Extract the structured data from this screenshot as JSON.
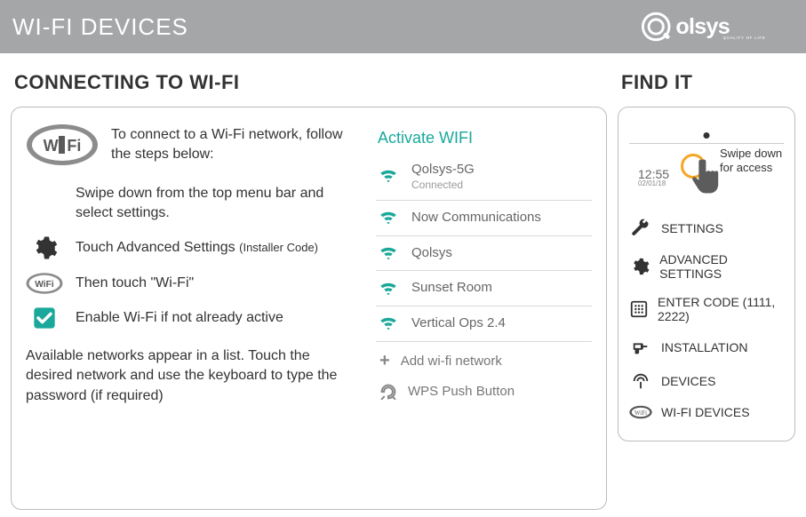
{
  "header": {
    "title": "WI-FI DEVICES",
    "brand": "Qolsys",
    "brand_tag": "QUALITY OF LIFE"
  },
  "main": {
    "title": "CONNECTING TO WI-FI",
    "intro": "To connect to a Wi-Fi network, follow the steps below:",
    "step1": "Swipe down from the top menu bar and select settings.",
    "step2": "Touch Advanced Settings",
    "step2_note": "(Installer Code)",
    "step3": "Then touch \"Wi-Fi\"",
    "step4": "Enable Wi-Fi if not already active",
    "footer": "Available networks appear in a list.  Touch the desired network and use the keyboard to type the password (if required)"
  },
  "phone": {
    "title": "Activate WIFI",
    "networks": [
      {
        "name": "Qolsys-5G",
        "status": "Connected"
      },
      {
        "name": "Now Communications",
        "status": ""
      },
      {
        "name": "Qolsys",
        "status": ""
      },
      {
        "name": "Sunset Room",
        "status": ""
      },
      {
        "name": "Vertical Ops 2.4",
        "status": ""
      }
    ],
    "add": "Add wi-fi network",
    "wps": "WPS Push Button"
  },
  "side": {
    "title": "FIND IT",
    "swipe_label": "Swipe down for access",
    "clock_time": "12:55",
    "clock_date": "02/01/18",
    "nav": [
      "SETTINGS",
      "ADVANCED SETTINGS",
      "ENTER CODE (1111, 2222)",
      "INSTALLATION",
      "DEVICES",
      "WI-FI DEVICES"
    ]
  }
}
